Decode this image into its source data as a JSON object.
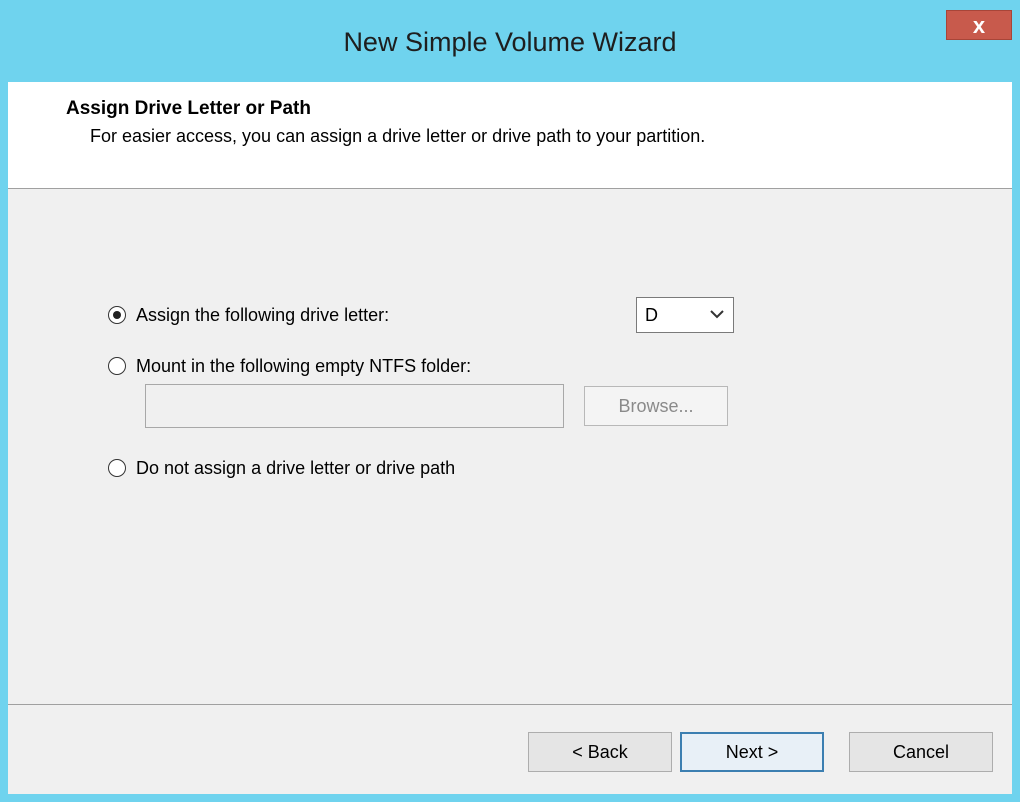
{
  "window": {
    "title": "New Simple Volume Wizard",
    "close_label": "x"
  },
  "header": {
    "title": "Assign Drive Letter or Path",
    "subtitle": "For easier access, you can assign a drive letter or drive path to your partition."
  },
  "options": {
    "assign_letter": {
      "label": "Assign the following drive letter:",
      "checked": true
    },
    "mount_folder": {
      "label": "Mount in the following empty NTFS folder:",
      "checked": false
    },
    "no_assign": {
      "label": "Do not assign a drive letter or drive path",
      "checked": false
    }
  },
  "drive_letter": {
    "selected": "D"
  },
  "folder_path": {
    "value": "",
    "browse_label": "Browse..."
  },
  "buttons": {
    "back": "< Back",
    "next": "Next >",
    "cancel": "Cancel"
  }
}
